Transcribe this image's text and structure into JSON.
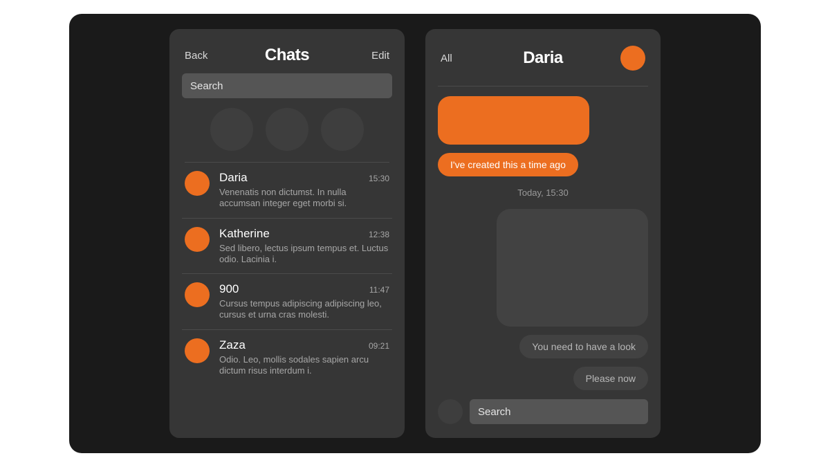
{
  "colors": {
    "accent": "#ec6e20",
    "surface": "#363636",
    "bg": "#1a1a1a"
  },
  "chats_screen": {
    "back_label": "Back",
    "title": "Chats",
    "edit_label": "Edit",
    "search_placeholder": "Search",
    "chats": [
      {
        "name": "Daria",
        "time": "15:30",
        "preview": "Venenatis non dictumst. In nulla accumsan integer eget morbi si."
      },
      {
        "name": "Katherine",
        "time": "12:38",
        "preview": "Sed libero, lectus ipsum tempus et. Luctus odio. Lacinia i."
      },
      {
        "name": "900",
        "time": "11:47",
        "preview": "Cursus tempus adipiscing adipiscing leo, cursus et urna cras molesti."
      },
      {
        "name": "Zaza",
        "time": "09:21",
        "preview": "Odio. Leo, mollis sodales sapien arcu dictum risus interdum i."
      }
    ]
  },
  "conversation_screen": {
    "all_label": "All",
    "contact_name": "Daria",
    "messages": [
      {
        "side": "sent",
        "kind": "media",
        "text": ""
      },
      {
        "side": "sent",
        "kind": "text",
        "text": "I've created this a time ago"
      },
      {
        "side": "divider",
        "kind": "timestamp",
        "text": "Today, 15:30"
      },
      {
        "side": "received",
        "kind": "media",
        "text": ""
      },
      {
        "side": "received",
        "kind": "text",
        "text": "You need to have a look"
      },
      {
        "side": "received",
        "kind": "text",
        "text": "Please now"
      }
    ],
    "input_placeholder": "Search"
  }
}
